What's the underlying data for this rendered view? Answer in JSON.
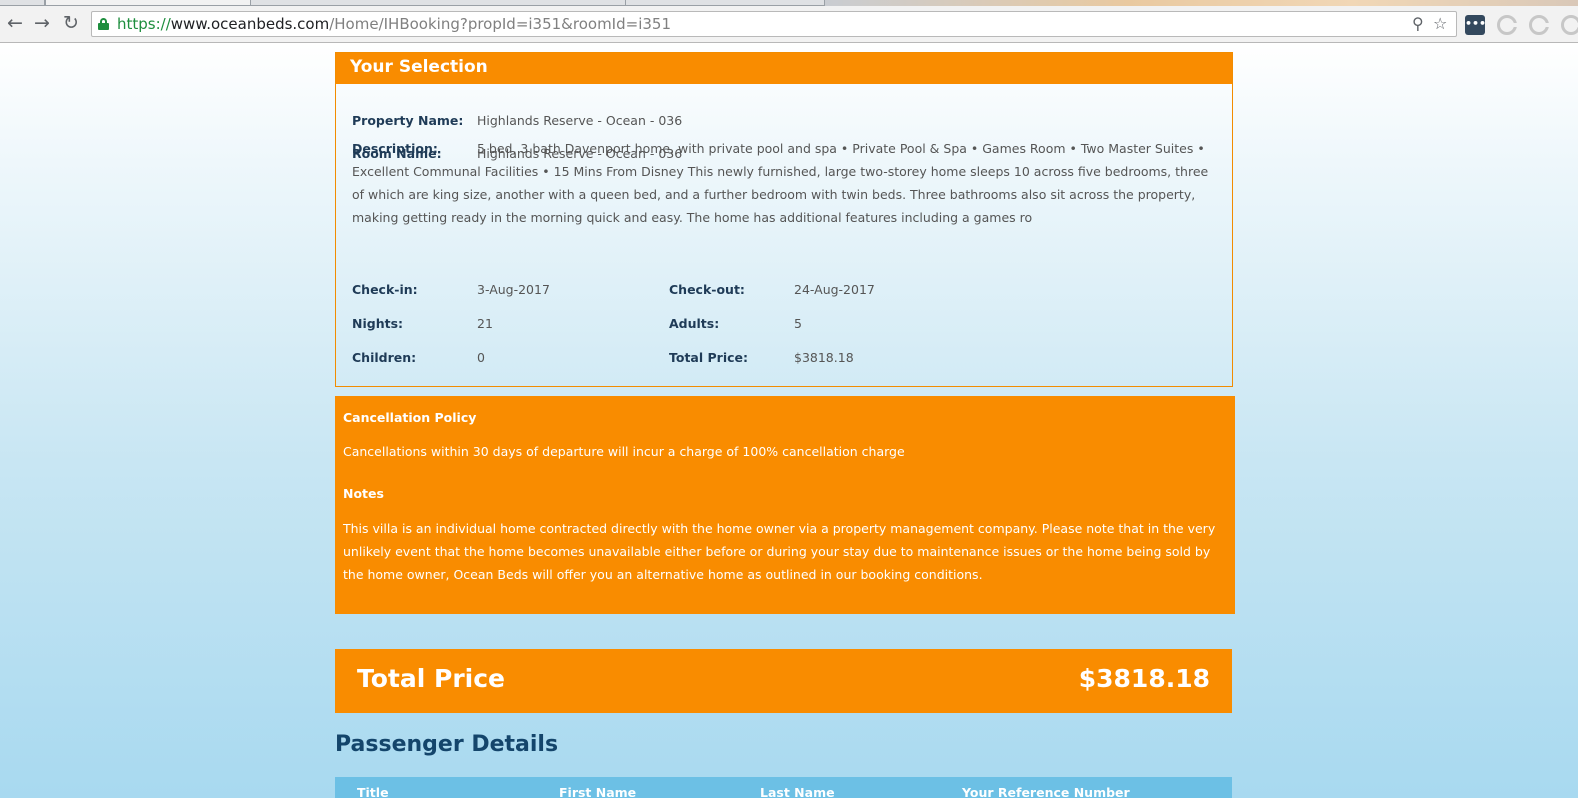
{
  "browser": {
    "url_scheme": "https://",
    "url_host": "www.oceanbeds.com",
    "url_path": "/Home/IHBooking?propId=i351&roomId=i351",
    "back_icon": "back-arrow-icon",
    "forward_icon": "forward-arrow-icon",
    "reload_icon": "reload-icon"
  },
  "selection": {
    "title": "Your Selection",
    "property_label": "Property Name:",
    "property_value": "Highlands Reserve - Ocean - 036",
    "room_label": "Room Name:",
    "room_value": "Highlands Reserve - Ocean - 036",
    "description_label": "Description:",
    "description_value": "5 bed, 3 bath Davenport home, with private pool and spa • Private Pool & Spa • Games Room • Two Master Suites • Excellent Communal Facilities • 15 Mins From Disney This newly furnished, large two-storey home sleeps 10 across five bedrooms, three of which are king size, another with a queen bed, and a further bedroom with twin beds. Three bathrooms also sit across the property, making getting ready in the morning quick and easy. The home has additional features including a games ro",
    "checkin_label": "Check-in:",
    "checkin_value": "3-Aug-2017",
    "checkout_label": "Check-out:",
    "checkout_value": "24-Aug-2017",
    "nights_label": "Nights:",
    "nights_value": "21",
    "adults_label": "Adults:",
    "adults_value": "5",
    "children_label": "Children:",
    "children_value": "0",
    "total_label": "Total Price:",
    "total_value": "$3818.18"
  },
  "policy": {
    "cancellation_title": "Cancellation Policy",
    "cancellation_text": "Cancellations within 30 days of departure will incur a charge of 100% cancellation charge",
    "notes_title": "Notes",
    "notes_text": "This villa is an individual home contracted directly with the home owner via a property management company. Please note that in the very unlikely event that the home becomes unavailable either before or during your stay due to maintenance issues or the home being sold by the home owner, Ocean Beds will offer you an alternative home as outlined in our booking conditions."
  },
  "total": {
    "label": "Total Price",
    "amount": "$3818.18"
  },
  "passenger": {
    "title": "Passenger Details",
    "columns": [
      "Title",
      "First Name",
      "Last Name",
      "Your Reference Number"
    ]
  },
  "colors": {
    "accent_orange": "#f98c00",
    "heading_navy": "#14456b",
    "table_head_blue": "#6cc0e5"
  }
}
